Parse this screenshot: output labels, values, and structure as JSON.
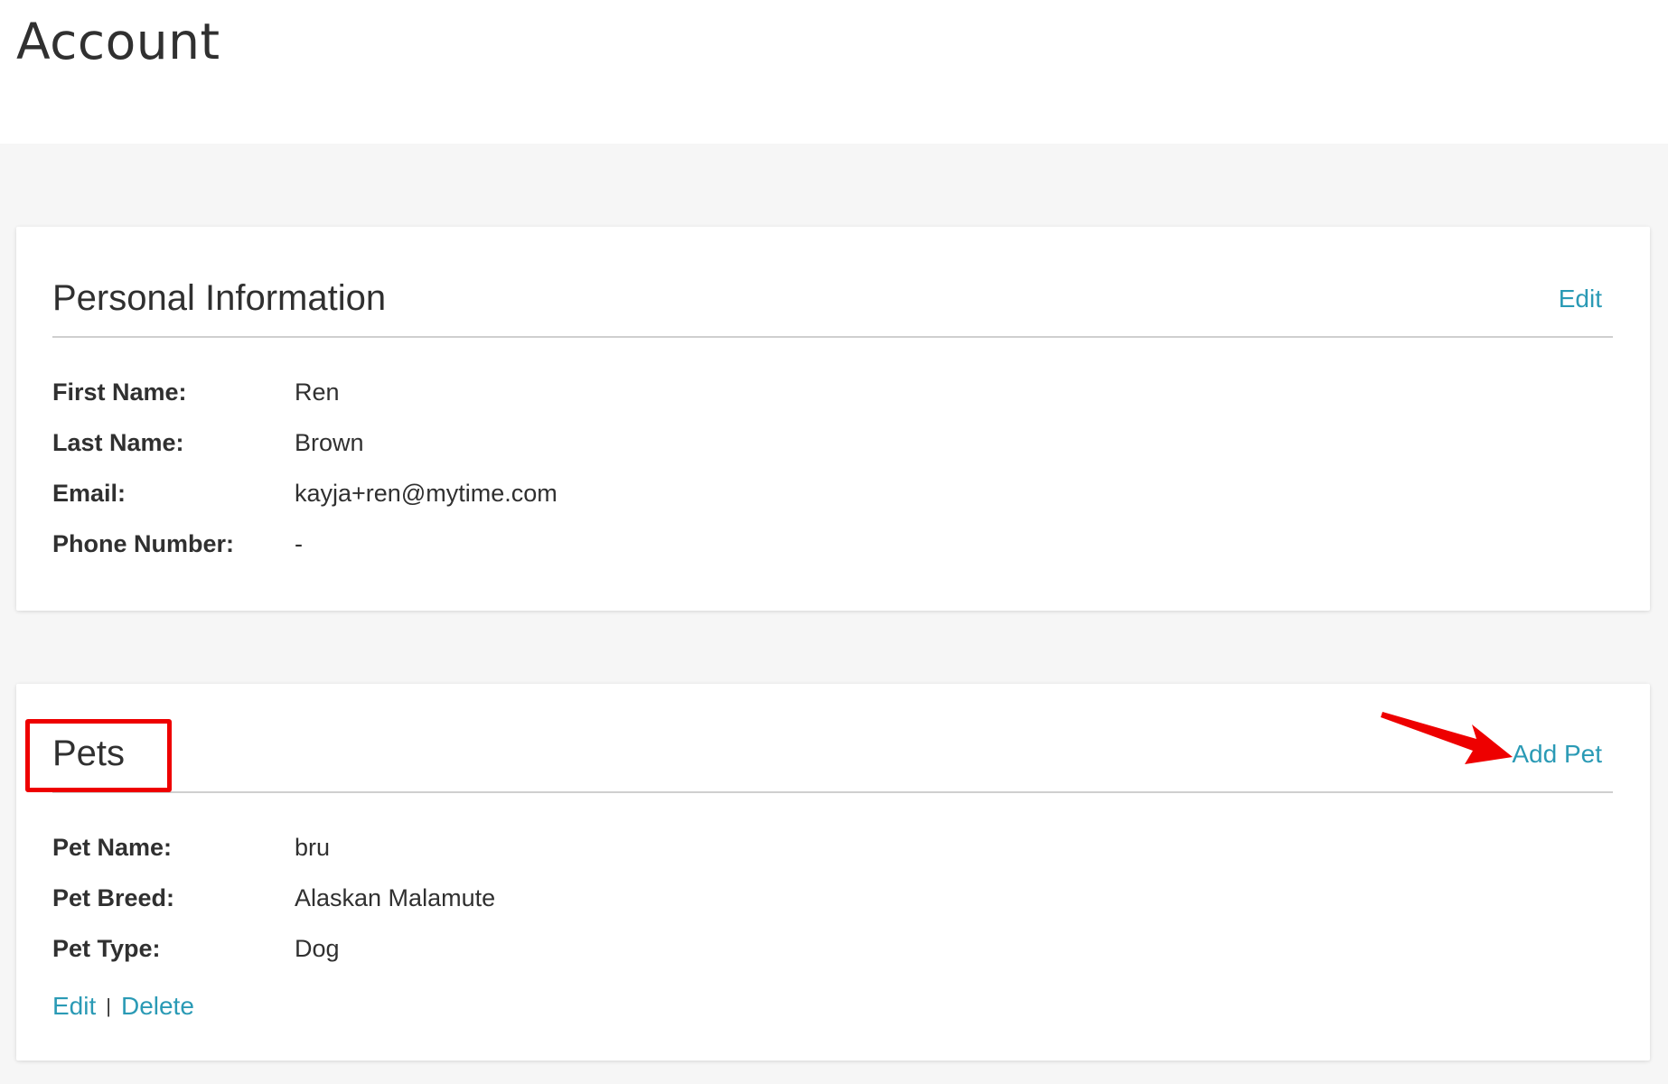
{
  "page": {
    "title": "Account"
  },
  "personal_info": {
    "title": "Personal Information",
    "edit_label": "Edit",
    "fields": [
      {
        "label": "First Name:",
        "value": "Ren"
      },
      {
        "label": "Last Name:",
        "value": "Brown"
      },
      {
        "label": "Email:",
        "value": "kayja+ren@mytime.com"
      },
      {
        "label": "Phone Number:",
        "value": "-"
      }
    ]
  },
  "pets": {
    "title": "Pets",
    "add_label": "Add Pet",
    "fields": [
      {
        "label": "Pet Name:",
        "value": "bru"
      },
      {
        "label": "Pet Breed:",
        "value": "Alaskan Malamute"
      },
      {
        "label": "Pet Type:",
        "value": "Dog"
      }
    ],
    "edit_label": "Edit",
    "separator": "|",
    "delete_label": "Delete"
  },
  "colors": {
    "link": "#2a9ab5",
    "annotation": "#ee0000",
    "background": "#f6f6f6"
  }
}
